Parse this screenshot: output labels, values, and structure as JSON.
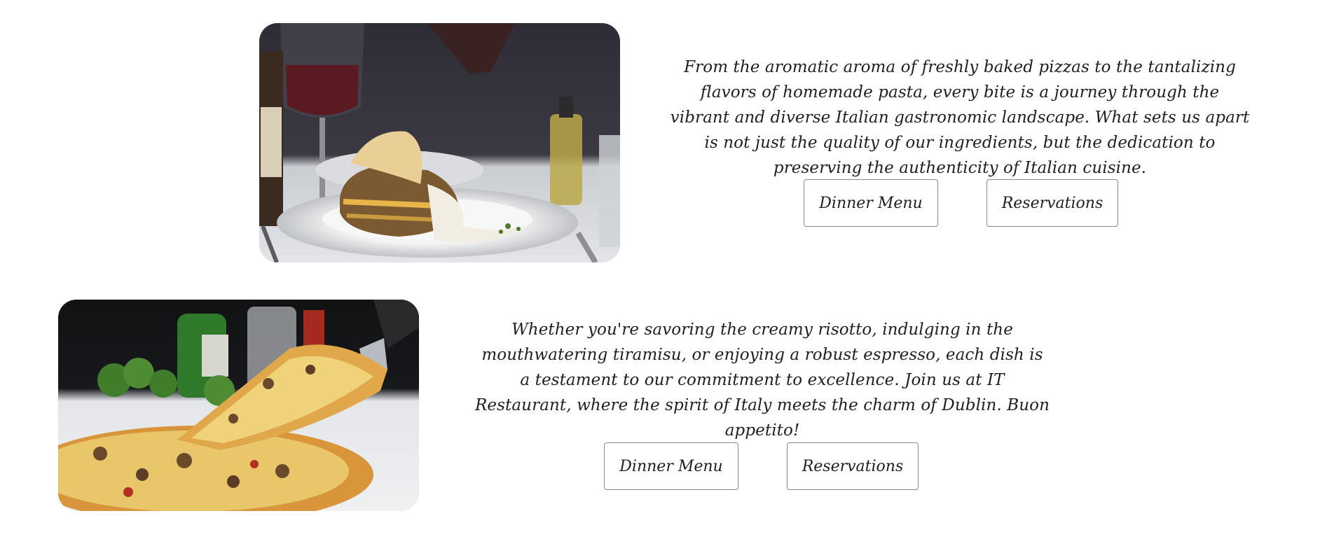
{
  "section1": {
    "image": {
      "label": "lasagna-plate-photo",
      "accent": "#2b2a33"
    },
    "paragraph": "From the aromatic aroma of freshly baked pizzas to the tantalizing flavors of homemade pasta, every bite is a journey through the vibrant and diverse Italian gastronomic landscape. What sets us apart is not just the quality of our ingredients, but the dedication to preserving the authenticity of Italian cuisine.",
    "buttons": {
      "dinner_menu": "Dinner Menu",
      "reservations": "Reservations"
    }
  },
  "section2": {
    "image": {
      "label": "pizza-slice-photo",
      "accent": "#e0a646"
    },
    "paragraph": "Whether you're savoring the creamy risotto, indulging in the mouthwatering tiramisu, or enjoying a robust espresso, each dish is a testament to our commitment to excellence. Join us at IT Restaurant, where the spirit of Italy meets the charm of Dublin. Buon appetito!",
    "buttons": {
      "dinner_menu": "Dinner Menu",
      "reservations": "Reservations"
    }
  },
  "colors": {
    "background": "#ffffff",
    "text": "#1f1f1f",
    "button_border": "#8a8a8a"
  }
}
